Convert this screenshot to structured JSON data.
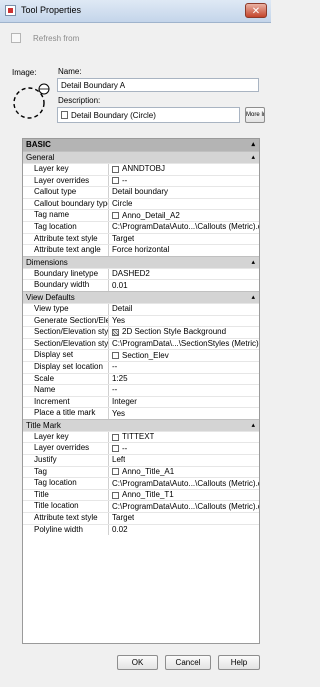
{
  "window": {
    "title": "Tool Properties",
    "close_glyph": "✕"
  },
  "refresh": {
    "label": "Refresh from"
  },
  "image": {
    "label": "Image:"
  },
  "name": {
    "label": "Name:",
    "value": "Detail Boundary A"
  },
  "description": {
    "label": "Description:",
    "value": "Detail Boundary (Circle)",
    "more_info": "More Info"
  },
  "grid": {
    "header": "BASIC",
    "collapse_glyph": "▴",
    "categories": [
      {
        "title": "General",
        "rows": [
          {
            "name": "Layer key",
            "value": "ANNDTOBJ",
            "icon": "layer-key-icon"
          },
          {
            "name": "Layer overrides",
            "value": "--",
            "icon": "layer-overrides-icon"
          },
          {
            "name": "Callout type",
            "value": "Detail boundary"
          },
          {
            "name": "Callout boundary type",
            "value": "Circle"
          },
          {
            "name": "Tag name",
            "value": "Anno_Detail_A2",
            "icon": "block-icon"
          },
          {
            "name": "Tag location",
            "value": "C:\\ProgramData\\Auto...\\Callouts (Metric).dwg"
          },
          {
            "name": "Attribute text style",
            "value": "Target"
          },
          {
            "name": "Attribute text angle",
            "value": "Force horizontal"
          }
        ]
      },
      {
        "title": "Dimensions",
        "rows": [
          {
            "name": "Boundary linetype",
            "value": "DASHED2"
          },
          {
            "name": "Boundary width",
            "value": "0.01"
          }
        ]
      },
      {
        "title": "View Defaults",
        "rows": [
          {
            "name": "View type",
            "value": "Detail"
          },
          {
            "name": "Generate Section/Ele...",
            "value": "Yes"
          },
          {
            "name": "Section/Elevation style",
            "value": "2D Section Style Background",
            "icon": "style-icon"
          },
          {
            "name": "Section/Elevation sty...",
            "value": "C:\\ProgramData\\...\\SectionStyles (Metric).dwg"
          },
          {
            "name": "Display set",
            "value": "Section_Elev",
            "icon": "display-set-icon"
          },
          {
            "name": "Display set location",
            "value": "--"
          },
          {
            "name": "Scale",
            "value": "1:25"
          },
          {
            "name": "Name",
            "value": "--"
          },
          {
            "name": "Increment",
            "value": "Integer"
          },
          {
            "name": "Place a title mark",
            "value": "Yes"
          }
        ]
      },
      {
        "title": "Title Mark",
        "rows": [
          {
            "name": "Layer key",
            "value": "TITTEXT",
            "icon": "layer-key-icon"
          },
          {
            "name": "Layer overrides",
            "value": "--",
            "icon": "layer-overrides-icon"
          },
          {
            "name": "Justify",
            "value": "Left"
          },
          {
            "name": "Tag",
            "value": "Anno_Title_A1",
            "icon": "block-icon"
          },
          {
            "name": "Tag location",
            "value": "C:\\ProgramData\\Auto...\\Callouts (Metric).dwg"
          },
          {
            "name": "Title",
            "value": "Anno_Title_T1",
            "icon": "block-icon"
          },
          {
            "name": "Title location",
            "value": "C:\\ProgramData\\Auto...\\Callouts (Metric).dwg"
          },
          {
            "name": "Attribute text style",
            "value": "Target"
          },
          {
            "name": "Polyline width",
            "value": "0.02"
          }
        ]
      }
    ]
  },
  "buttons": {
    "ok": "OK",
    "cancel": "Cancel",
    "help": "Help"
  }
}
